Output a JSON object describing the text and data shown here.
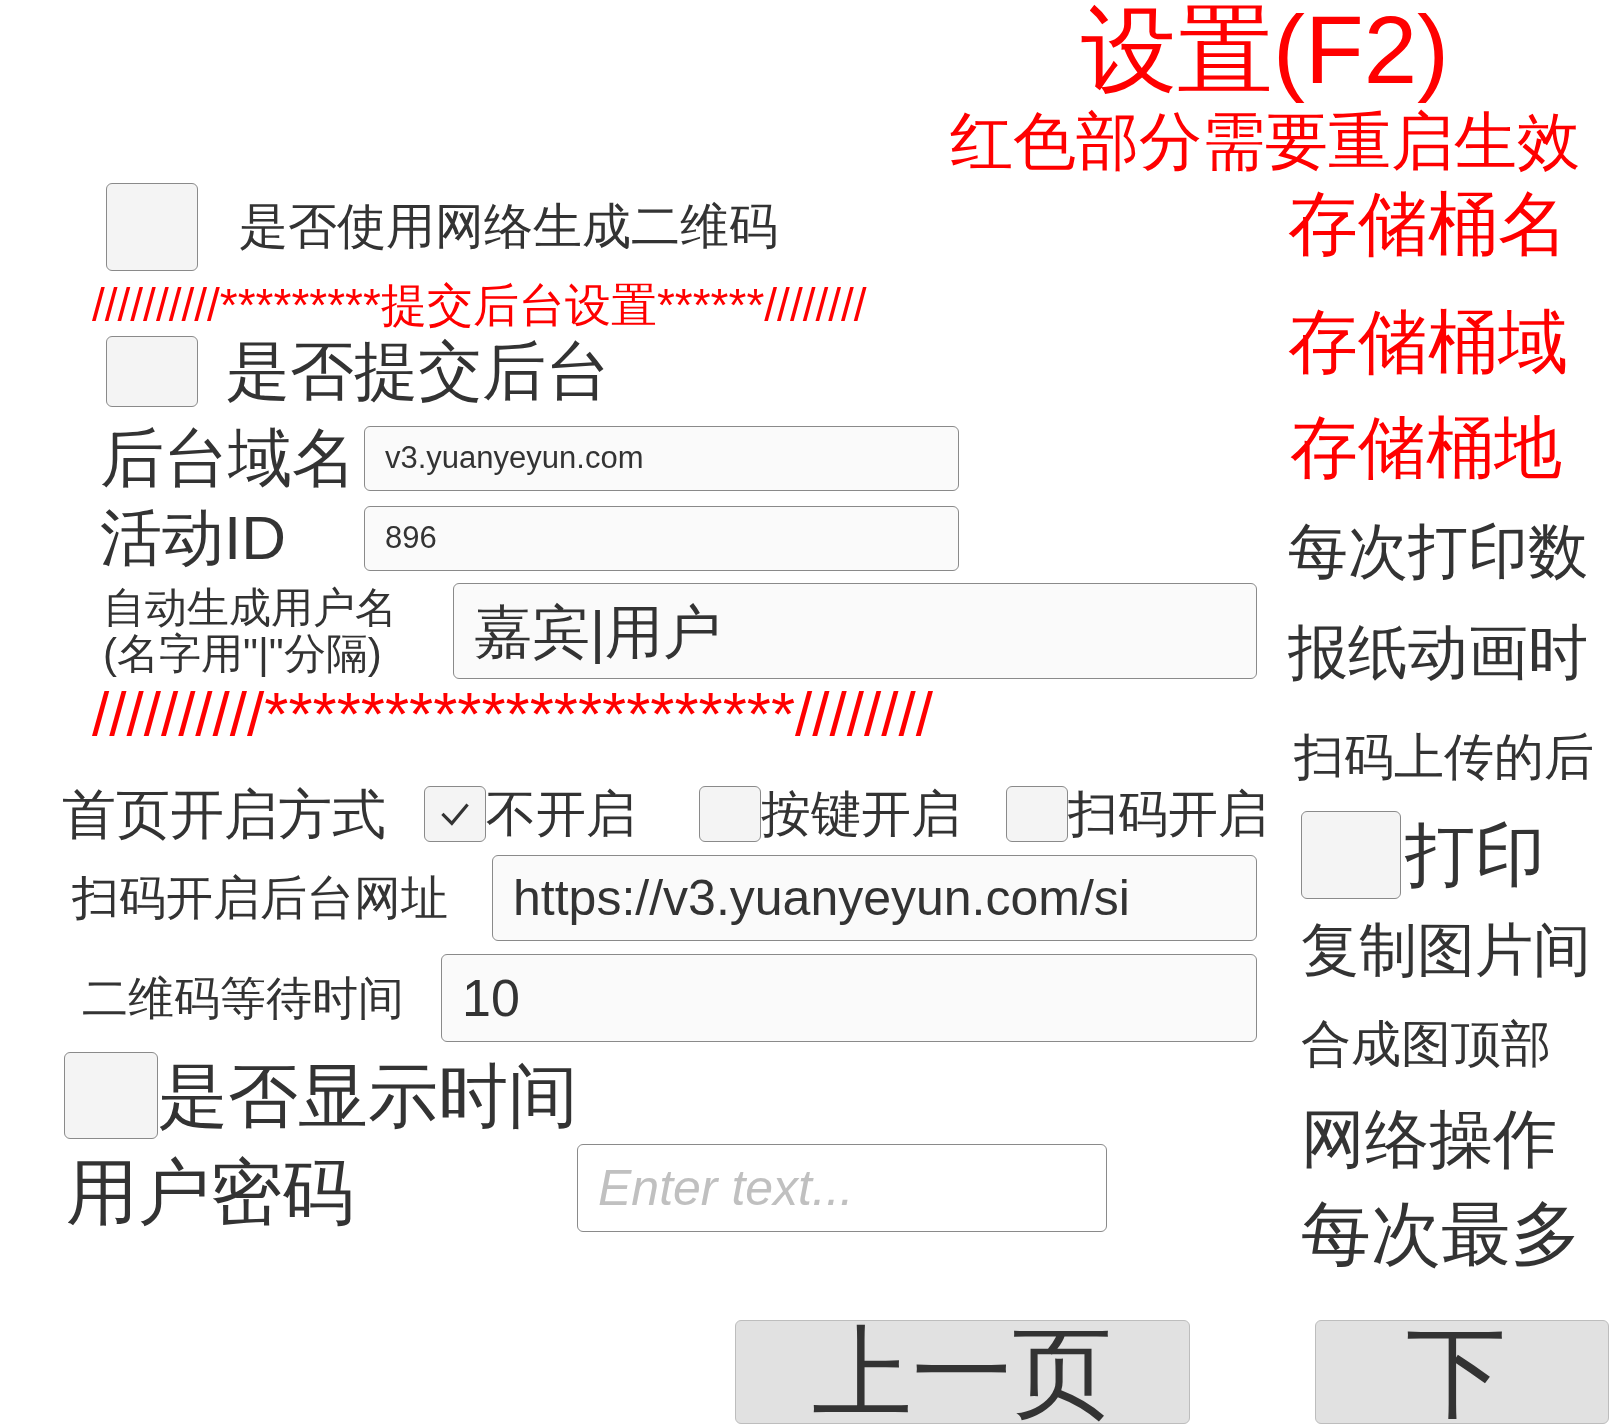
{
  "header": {
    "title": "设置(F2)",
    "subtitle": "红色部分需要重启生效"
  },
  "network_qr": {
    "label": "是否使用网络生成二维码",
    "checked": false
  },
  "submit_divider": "//////////*********提交后台设置******////////",
  "submit_backend": {
    "label": "是否提交后台",
    "checked": false
  },
  "backend_domain": {
    "label": "后台域名",
    "value": "v3.yuanyeyun.com"
  },
  "activity_id": {
    "label": "活动ID",
    "value": "896"
  },
  "auto_username": {
    "label": "自动生成用户名",
    "hint": "(名字用\"|\"分隔)",
    "value": "嘉宾|用户"
  },
  "end_divider": "//////////**********************////////",
  "homepage_mode": {
    "label": "首页开启方式",
    "options": [
      {
        "label": "不开启",
        "selected": true
      },
      {
        "label": "按键开启",
        "selected": false
      },
      {
        "label": "扫码开启",
        "selected": false
      }
    ]
  },
  "scan_url": {
    "label": "扫码开启后台网址",
    "value": "https://v3.yuanyeyun.com/si"
  },
  "qr_wait": {
    "label": "二维码等待时间",
    "value": "10"
  },
  "show_time": {
    "label": "是否显示时间",
    "checked": false
  },
  "password": {
    "label": "用户密码",
    "placeholder": "Enter text..."
  },
  "right_items": [
    {
      "kind": "label",
      "text": "存储桶名",
      "color": "#ff0000"
    },
    {
      "kind": "label",
      "text": "存储桶域",
      "color": "#ff0000"
    },
    {
      "kind": "label",
      "text": "存储桶地",
      "color": "#ff0000"
    },
    {
      "kind": "label",
      "text": "每次打印数",
      "color": "#333333"
    },
    {
      "kind": "label",
      "text": "报纸动画时",
      "color": "#333333"
    },
    {
      "kind": "label",
      "text": "扫码上传的后",
      "color": "#333333"
    },
    {
      "kind": "checkbox",
      "text": "打印",
      "checked": false,
      "color": "#333333"
    },
    {
      "kind": "label",
      "text": "复制图片间",
      "color": "#333333"
    },
    {
      "kind": "label",
      "text": "合成图顶部",
      "color": "#333333"
    },
    {
      "kind": "label",
      "text": "网络操作",
      "color": "#333333"
    },
    {
      "kind": "label",
      "text": "每次最多",
      "color": "#333333"
    }
  ],
  "buttons": [
    {
      "label": "上一页"
    },
    {
      "label": "下"
    }
  ]
}
